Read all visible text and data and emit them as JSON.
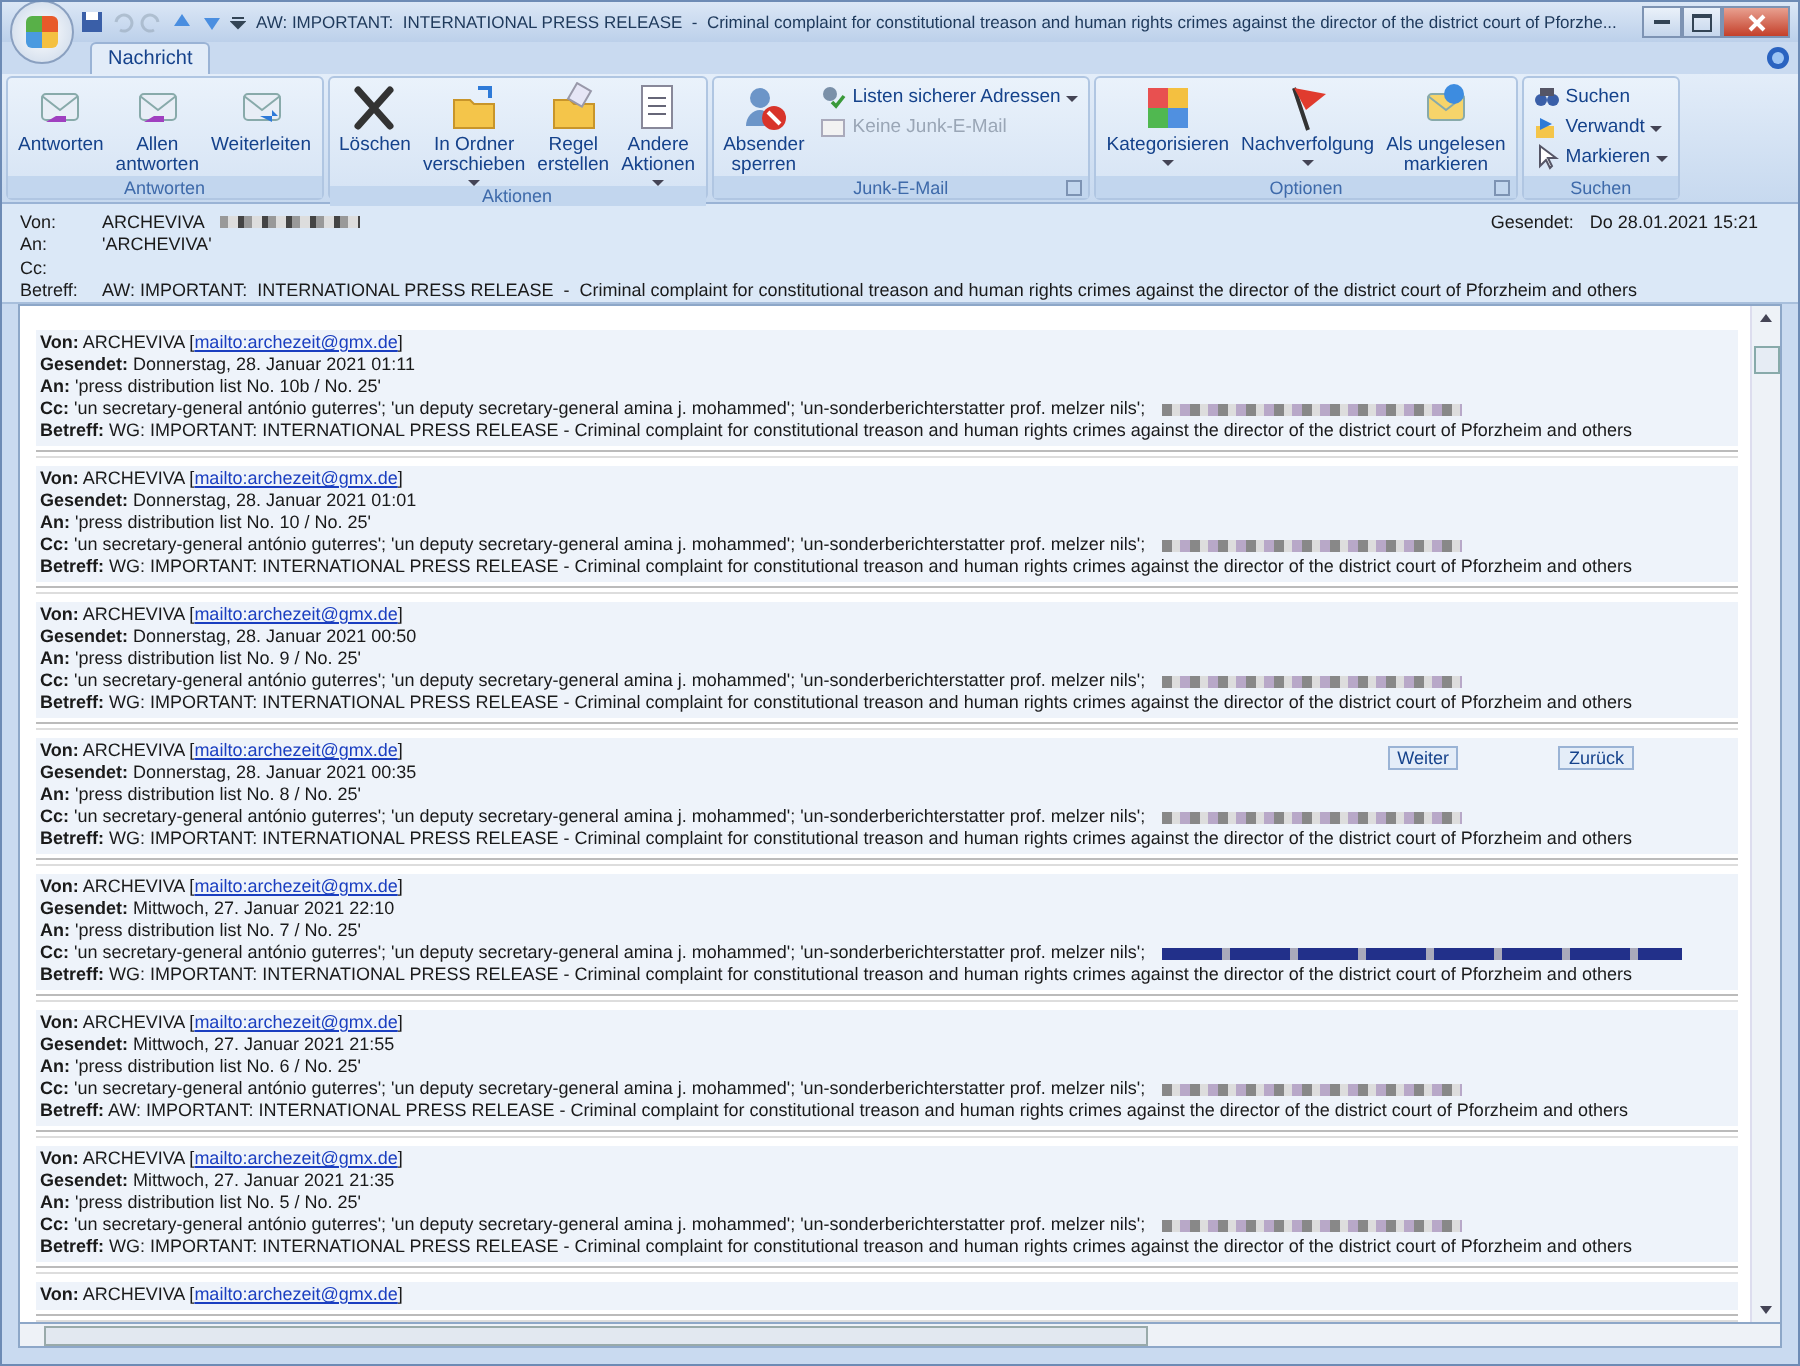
{
  "window": {
    "title": "AW: IMPORTANT:  INTERNATIONAL PRESS RELEASE  -  Criminal complaint for constitutional treason and human rights crimes against the director of the district court of Pforzhe..."
  },
  "tabs": [
    {
      "label": "Nachricht",
      "selected": true
    }
  ],
  "ribbon": [
    {
      "label": "Antworten",
      "launcher": false,
      "buttons": [
        {
          "kind": "large",
          "label": "Antworten",
          "menu": false,
          "disabled": false
        },
        {
          "kind": "large",
          "label": "Allen\nantworten",
          "menu": false,
          "disabled": false
        },
        {
          "kind": "large",
          "label": "Weiterleiten",
          "menu": false,
          "disabled": false
        }
      ]
    },
    {
      "label": "Aktionen",
      "launcher": false,
      "buttons": [
        {
          "kind": "large",
          "label": "Löschen",
          "menu": false,
          "disabled": false
        },
        {
          "kind": "large",
          "label": "In Ordner\nverschieben",
          "menu": true,
          "disabled": false
        },
        {
          "kind": "large",
          "label": "Regel\nerstellen",
          "menu": false,
          "disabled": false
        },
        {
          "kind": "large",
          "label": "Andere\nAktionen",
          "menu": true,
          "disabled": false
        }
      ]
    },
    {
      "label": "Junk-E-Mail",
      "launcher": true,
      "buttons": [
        {
          "kind": "large",
          "label": "Absender\nsperren",
          "menu": false,
          "disabled": false
        },
        {
          "kind": "small",
          "label": "Listen sicherer Adressen",
          "menu": true,
          "disabled": false
        },
        {
          "kind": "small",
          "label": "Keine Junk-E-Mail",
          "menu": false,
          "disabled": true
        }
      ]
    },
    {
      "label": "Optionen",
      "launcher": true,
      "buttons": [
        {
          "kind": "large",
          "label": "Kategorisieren",
          "menu": true,
          "disabled": false
        },
        {
          "kind": "large",
          "label": "Nachverfolgung",
          "menu": true,
          "disabled": false
        },
        {
          "kind": "large",
          "label": "Als ungelesen\nmarkieren",
          "menu": false,
          "disabled": false
        }
      ]
    },
    {
      "label": "Suchen",
      "launcher": false,
      "buttons": [
        {
          "kind": "small",
          "label": "Suchen",
          "menu": false,
          "disabled": false
        },
        {
          "kind": "small",
          "label": "Verwandt",
          "menu": true,
          "disabled": false
        },
        {
          "kind": "small",
          "label": "Markieren",
          "menu": true,
          "disabled": false
        }
      ]
    }
  ],
  "header": {
    "fields": [
      {
        "label": "Von:",
        "value": "ARCHEVIVA"
      },
      {
        "label": "An:",
        "value": "'ARCHEVIVA'"
      },
      {
        "label": "Cc:"
      },
      {
        "label": "Betreff:",
        "value": "AW: IMPORTANT:  INTERNATIONAL PRESS RELEASE  -  Criminal complaint for constitutional treason and human rights crimes against the director of the district court of Pforzheim and others"
      }
    ],
    "sent_label": "Gesendet:",
    "sent": "Do 28.01.2021 15:21"
  },
  "messages": [
    {
      "from_label": "Von:",
      "from": "ARCHEVIVA [",
      "link": "mailto:archezeit@gmx.de",
      "from_end": "]",
      "lines": [
        {
          "label": "Gesendet:",
          "value": "Donnerstag, 28. Januar 2021 01:11"
        },
        {
          "label": "An:",
          "value": "'press distribution list No. 10b / No. 25'"
        },
        {
          "label": "Cc:",
          "value": "'un secretary-general antónio guterres'; 'un deputy secretary-general amina j. mohammed'; 'un-sonderberichterstatter prof. melzer nils';"
        },
        {
          "label": "Betreff:",
          "value": "WG: IMPORTANT: INTERNATIONAL PRESS RELEASE - Criminal complaint for constitutional treason and human rights crimes against the director of the district court of Pforzheim and others"
        }
      ]
    },
    {
      "from_label": "Von:",
      "from": "ARCHEVIVA [",
      "link": "mailto:archezeit@gmx.de",
      "from_end": "]",
      "lines": [
        {
          "label": "Gesendet:",
          "value": "Donnerstag, 28. Januar 2021 01:01"
        },
        {
          "label": "An:",
          "value": "'press distribution list No. 10 / No. 25'"
        },
        {
          "label": "Cc:",
          "value": "'un secretary-general antónio guterres'; 'un deputy secretary-general amina j. mohammed'; 'un-sonderberichterstatter prof. melzer nils';"
        },
        {
          "label": "Betreff:",
          "value": "WG: IMPORTANT: INTERNATIONAL PRESS RELEASE - Criminal complaint for constitutional treason and human rights crimes against the director of the district court of Pforzheim and others"
        }
      ]
    },
    {
      "from_label": "Von:",
      "from": "ARCHEVIVA [",
      "link": "mailto:archezeit@gmx.de",
      "from_end": "]",
      "lines": [
        {
          "label": "Gesendet:",
          "value": "Donnerstag, 28. Januar 2021 00:50"
        },
        {
          "label": "An:",
          "value": "'press distribution list No. 9 / No. 25'"
        },
        {
          "label": "Cc:",
          "value": "'un secretary-general antónio guterres'; 'un deputy secretary-general amina j. mohammed'; 'un-sonderberichterstatter prof. melzer nils';"
        },
        {
          "label": "Betreff:",
          "value": "WG: IMPORTANT: INTERNATIONAL PRESS RELEASE - Criminal complaint for constitutional treason and human rights crimes against the director of the district court of Pforzheim and others"
        }
      ]
    },
    {
      "from_label": "Von:",
      "from": "ARCHEVIVA [",
      "link": "mailto:archezeit@gmx.de",
      "from_end": "]",
      "nav": [
        "Weiter",
        "Zurück"
      ],
      "lines": [
        {
          "label": "Gesendet:",
          "value": "Donnerstag, 28. Januar 2021 00:35"
        },
        {
          "label": "An:",
          "value": "'press distribution list No. 8 / No. 25'"
        },
        {
          "label": "Cc:",
          "value": "'un secretary-general antónio guterres'; 'un deputy secretary-general amina j. mohammed'; 'un-sonderberichterstatter prof. melzer nils';"
        },
        {
          "label": "Betreff:",
          "value": "WG: IMPORTANT: INTERNATIONAL PRESS RELEASE - Criminal complaint for constitutional treason and human rights crimes against the director of the district court of Pforzheim and others"
        }
      ]
    },
    {
      "from_label": "Von:",
      "from": "ARCHEVIVA [",
      "link": "mailto:archezeit@gmx.de",
      "from_end": "]",
      "lines": [
        {
          "label": "Gesendet:",
          "value": "Mittwoch, 27. Januar 2021 22:10"
        },
        {
          "label": "An:",
          "value": "'press distribution list No. 7 / No. 25'"
        },
        {
          "label": "Cc:",
          "value": "'un secretary-general antónio guterres'; 'un deputy secretary-general amina j. mohammed'; 'un-sonderberichterstatter prof. melzer nils';"
        },
        {
          "label": "Betreff:",
          "value": "WG: IMPORTANT: INTERNATIONAL PRESS RELEASE - Criminal complaint for constitutional treason and human rights crimes against the director of the district court of Pforzheim and others"
        }
      ]
    },
    {
      "from_label": "Von:",
      "from": "ARCHEVIVA [",
      "link": "mailto:archezeit@gmx.de",
      "from_end": "]",
      "lines": [
        {
          "label": "Gesendet:",
          "value": "Mittwoch, 27. Januar 2021 21:55"
        },
        {
          "label": "An:",
          "value": "'press distribution list No. 6 / No. 25'"
        },
        {
          "label": "Cc:",
          "value": "'un secretary-general antónio guterres'; 'un deputy secretary-general amina j. mohammed'; 'un-sonderberichterstatter prof. melzer nils';"
        },
        {
          "label": "Betreff:",
          "value": "AW: IMPORTANT: INTERNATIONAL PRESS RELEASE - Criminal complaint for constitutional treason and human rights crimes against the director of the district court of Pforzheim and others"
        }
      ]
    },
    {
      "from_label": "Von:",
      "from": "ARCHEVIVA [",
      "link": "mailto:archezeit@gmx.de",
      "from_end": "]",
      "lines": [
        {
          "label": "Gesendet:",
          "value": "Mittwoch, 27. Januar 2021 21:35"
        },
        {
          "label": "An:",
          "value": "'press distribution list No. 5 / No. 25'"
        },
        {
          "label": "Cc:",
          "value": "'un secretary-general antónio guterres'; 'un deputy secretary-general amina j. mohammed'; 'un-sonderberichterstatter prof. melzer nils';"
        },
        {
          "label": "Betreff:",
          "value": "WG: IMPORTANT: INTERNATIONAL PRESS RELEASE - Criminal complaint for constitutional treason and human rights crimes against the director of the district court of Pforzheim and others"
        }
      ]
    },
    {
      "from_label": "Von:",
      "from": "ARCHEVIVA [",
      "link": "mailto:archezeit@gmx.de",
      "from_end": "]"
    }
  ]
}
